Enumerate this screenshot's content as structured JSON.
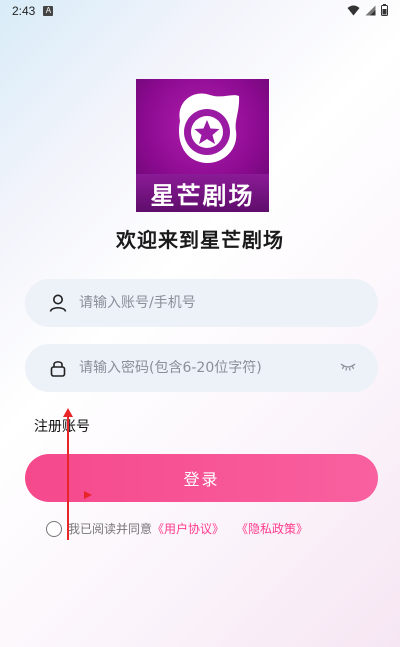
{
  "status_bar": {
    "time": "2:43",
    "notification_badge": "A"
  },
  "app": {
    "logo_text": "星芒剧场",
    "welcome_text": "欢迎来到星芒剧场"
  },
  "form": {
    "account_placeholder": "请输入账号/手机号",
    "password_placeholder": "请输入密码(包含6-20位字符)",
    "register_label": "注册账号",
    "login_label": "登录"
  },
  "agreement": {
    "prefix": "我已阅读并同意",
    "user_agreement": "《用户协议》",
    "privacy_policy": "《隐私政策》"
  },
  "colors": {
    "accent": "#f5498c",
    "link": "#ff3c8e",
    "logo_purple": "#8a0a8f"
  }
}
